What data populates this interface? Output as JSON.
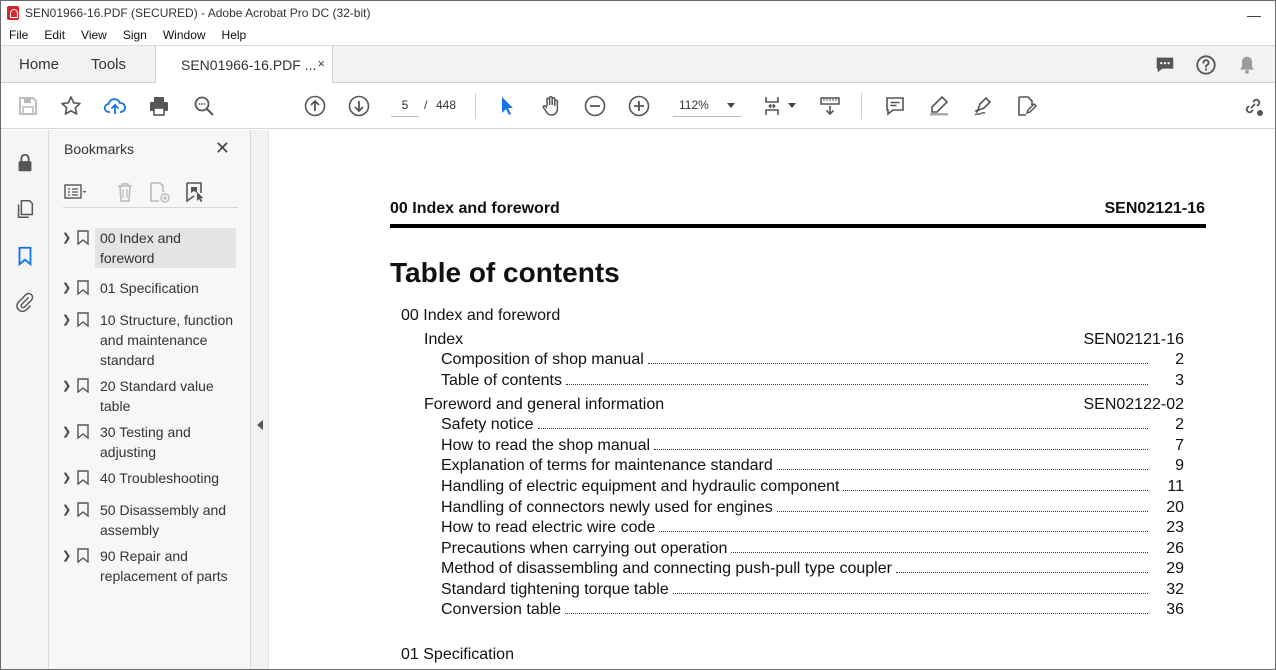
{
  "window": {
    "title": "SEN01966-16.PDF (SECURED) - Adobe Acrobat Pro DC (32-bit)",
    "minimize": "—"
  },
  "menu": [
    "File",
    "Edit",
    "View",
    "Sign",
    "Window",
    "Help"
  ],
  "tabs": {
    "home": "Home",
    "tools": "Tools",
    "doc": "SEN01966-16.PDF ...",
    "close": "×"
  },
  "toolbar": {
    "page_current": "5",
    "page_sep": "/",
    "page_total": "448",
    "zoom": "112%"
  },
  "bookmarks": {
    "header": "Bookmarks",
    "close": "✕",
    "items": [
      {
        "label": "00 Index and foreword",
        "selected": true
      },
      {
        "label": "01 Specification"
      },
      {
        "label": "10 Structure, function and maintenance standard"
      },
      {
        "label": "20 Standard value table"
      },
      {
        "label": "30 Testing and adjusting"
      },
      {
        "label": "40 Troubleshooting"
      },
      {
        "label": "50 Disassembly and assembly"
      },
      {
        "label": "90 Repair and replacement of parts"
      }
    ]
  },
  "document": {
    "header_left": "00 Index and foreword",
    "header_right": "SEN02121-16",
    "title": "Table of contents",
    "toc": [
      {
        "level": 0,
        "text": "00 Index and foreword",
        "ref": ""
      },
      {
        "level": 1,
        "text": "Index",
        "ref": "SEN02121-16"
      },
      {
        "level": 2,
        "text": "Composition of shop manual",
        "ref": "2"
      },
      {
        "level": 2,
        "text": "Table of contents",
        "ref": "3"
      },
      {
        "level": 1,
        "text": "Foreword and general information",
        "ref": "SEN02122-02"
      },
      {
        "level": 2,
        "text": "Safety notice",
        "ref": "2"
      },
      {
        "level": 2,
        "text": "How to read the shop manual",
        "ref": "7"
      },
      {
        "level": 2,
        "text": "Explanation of terms for maintenance standard",
        "ref": "9"
      },
      {
        "level": 2,
        "text": "Handling of electric equipment and hydraulic component",
        "ref": "11"
      },
      {
        "level": 2,
        "text": "Handling of connectors newly used for engines",
        "ref": "20"
      },
      {
        "level": 2,
        "text": "How to read electric wire code",
        "ref": "23"
      },
      {
        "level": 2,
        "text": "Precautions when carrying out operation",
        "ref": "26"
      },
      {
        "level": 2,
        "text": "Method of disassembling and connecting push-pull type coupler",
        "ref": "29"
      },
      {
        "level": 2,
        "text": "Standard tightening torque table",
        "ref": "32"
      },
      {
        "level": 2,
        "text": "Conversion table",
        "ref": "36"
      },
      {
        "level": 0,
        "text": "01 Specification",
        "ref": ""
      }
    ]
  }
}
